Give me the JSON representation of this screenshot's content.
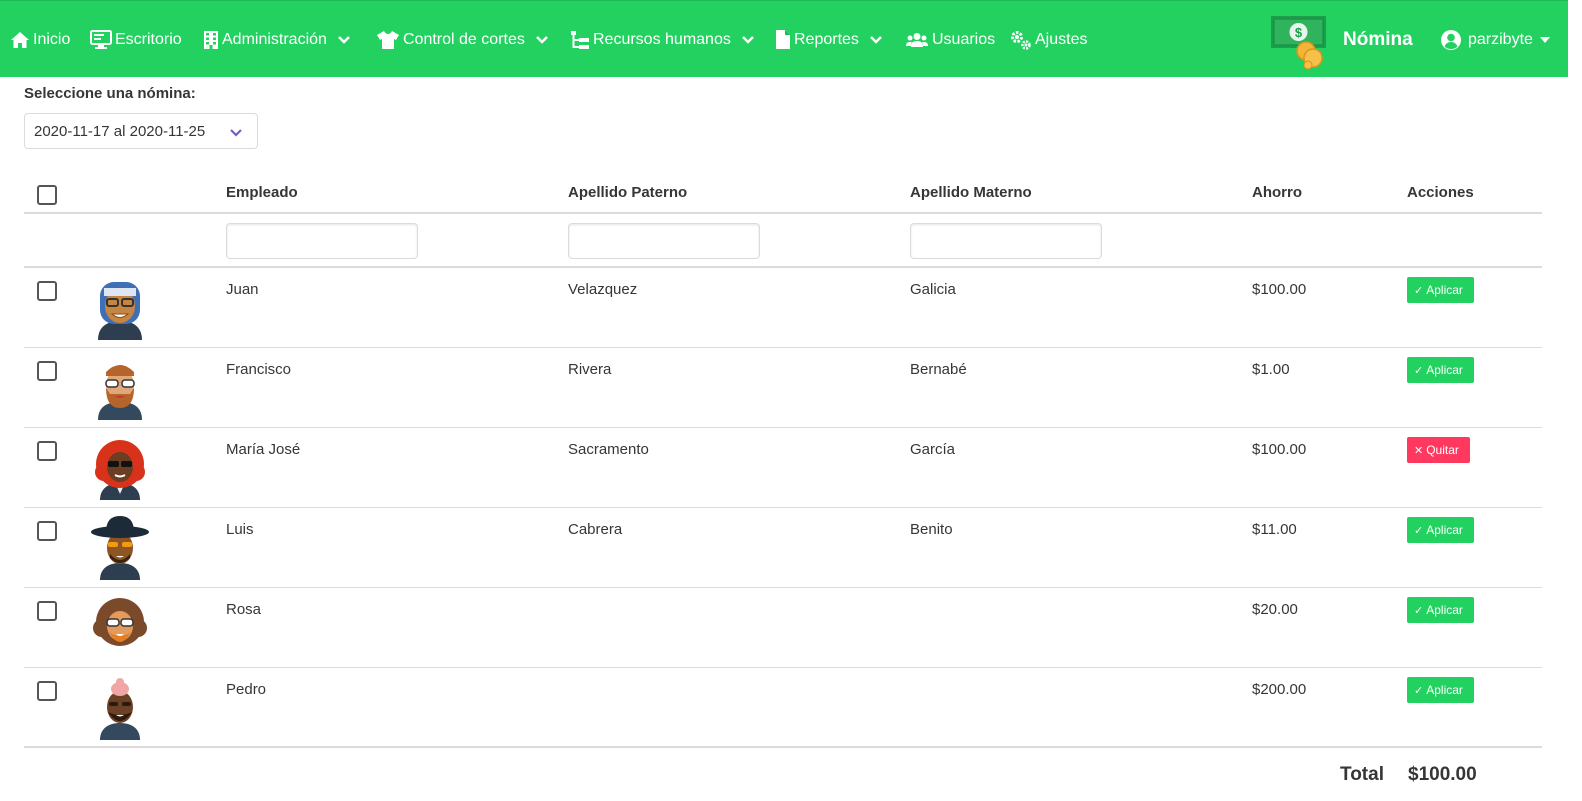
{
  "nav": {
    "items": [
      {
        "label": "Inicio",
        "icon": "home-icon"
      },
      {
        "label": "Escritorio",
        "icon": "desktop-icon"
      },
      {
        "label": "Administración",
        "icon": "building-icon",
        "dropdown": true
      },
      {
        "label": "Control de cortes",
        "icon": "shirt-icon",
        "dropdown": true
      },
      {
        "label": "Recursos humanos",
        "icon": "sitemap-icon",
        "dropdown": true
      },
      {
        "label": "Reportes",
        "icon": "file-icon",
        "dropdown": true
      },
      {
        "label": "Usuarios",
        "icon": "users-icon"
      },
      {
        "label": "Ajustes",
        "icon": "gears-icon"
      }
    ],
    "brand_title": "Nómina",
    "user_name": "parzibyte"
  },
  "nomina": {
    "label": "Seleccione una nómina:",
    "selected": "2020-11-17 al 2020-11-25"
  },
  "table": {
    "headers": {
      "empleado": "Empleado",
      "apellido_paterno": "Apellido Paterno",
      "apellido_materno": "Apellido Materno",
      "ahorro": "Ahorro",
      "acciones": "Acciones"
    },
    "rows": [
      {
        "nombre": "Juan",
        "paterno": "Velazquez",
        "materno": "Galicia",
        "ahorro": "$100.00",
        "accion": "Aplicar",
        "accion_tipo": "apply"
      },
      {
        "nombre": "Francisco",
        "paterno": "Rivera",
        "materno": "Bernabé",
        "ahorro": "$1.00",
        "accion": "Aplicar",
        "accion_tipo": "apply"
      },
      {
        "nombre": "María José",
        "paterno": "Sacramento",
        "materno": "García",
        "ahorro": "$100.00",
        "accion": "Quitar",
        "accion_tipo": "remove"
      },
      {
        "nombre": "Luis",
        "paterno": "Cabrera",
        "materno": "Benito",
        "ahorro": "$11.00",
        "accion": "Aplicar",
        "accion_tipo": "apply"
      },
      {
        "nombre": "Rosa",
        "paterno": "",
        "materno": "",
        "ahorro": "$20.00",
        "accion": "Aplicar",
        "accion_tipo": "apply"
      },
      {
        "nombre": "Pedro",
        "paterno": "",
        "materno": "",
        "ahorro": "$200.00",
        "accion": "Aplicar",
        "accion_tipo": "apply"
      }
    ]
  },
  "total": {
    "label": "Total",
    "value": "$100.00"
  },
  "colors": {
    "primary": "#23d160",
    "danger": "#ff3860"
  }
}
